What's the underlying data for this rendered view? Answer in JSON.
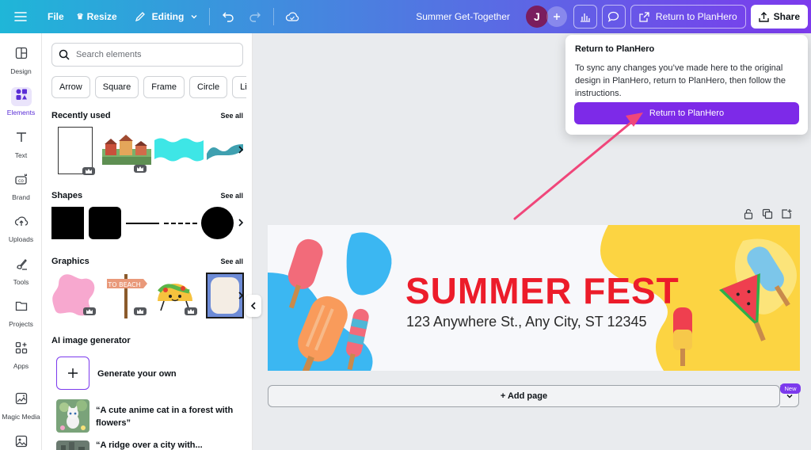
{
  "topbar": {
    "file": "File",
    "resize": "Resize",
    "editing": "Editing",
    "doc_title": "Summer Get-Together",
    "avatar_initial": "J",
    "return_label": "Return to PlanHero",
    "share_label": "Share"
  },
  "rail": {
    "items": [
      {
        "label": "Design",
        "icon": "design-icon"
      },
      {
        "label": "Elements",
        "icon": "elements-icon"
      },
      {
        "label": "Text",
        "icon": "text-icon"
      },
      {
        "label": "Brand",
        "icon": "brand-icon"
      },
      {
        "label": "Uploads",
        "icon": "uploads-icon"
      },
      {
        "label": "Tools",
        "icon": "tools-icon"
      },
      {
        "label": "Projects",
        "icon": "projects-icon"
      },
      {
        "label": "Apps",
        "icon": "apps-icon"
      },
      {
        "label": "Magic Media",
        "icon": "magic-media-icon"
      }
    ]
  },
  "panel": {
    "search_placeholder": "Search elements",
    "chips": [
      "Arrow",
      "Square",
      "Frame",
      "Circle",
      "Li"
    ],
    "recently_used": "Recently used",
    "shapes": "Shapes",
    "graphics": "Graphics",
    "see_all": "See all",
    "ai_generator": "AI image generator",
    "generate_own": "Generate your own",
    "prompt_1": "“A cute anime cat in a forest with flowers”",
    "prompt_2": "“A ridge over a city with..."
  },
  "design": {
    "title": "SUMMER FEST",
    "address": "123 Anywhere St., Any City, ST 12345",
    "sign_text": "TO BEACH"
  },
  "canvas": {
    "add_page": "+ Add page",
    "new_badge": "New"
  },
  "popup": {
    "title": "Return to PlanHero",
    "body": "To sync any changes you’ve made here to the original design in PlanHero, return to PlanHero, then follow the instructions.",
    "button": "Return to PlanHero"
  },
  "colors": {
    "accent": "#7d2ae8",
    "title_red": "#ec1c2a",
    "arrow_pink": "#f0467a"
  }
}
